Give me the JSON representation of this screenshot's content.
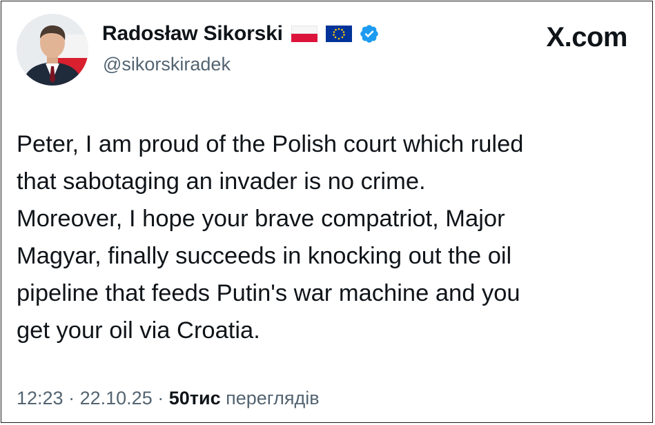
{
  "author": {
    "display_name": "Radosław Sikorski",
    "handle": "@sikorskiradek",
    "badges": [
      "flag-poland-icon",
      "flag-eu-icon",
      "verified-badge-icon"
    ]
  },
  "brand": {
    "label": "X.com"
  },
  "tweet": {
    "text": "Peter, I am proud of the Polish court which ruled\nthat sabotaging an invader is no crime.\nMoreover, I hope your brave compatriot, Major\nMagyar, finally succeeds in knocking out the oil\npipeline that feeds Putin's war machine and you\nget your oil via Croatia."
  },
  "meta": {
    "time": "12:23",
    "separator": "·",
    "date": "22.10.25",
    "views_count": "50тис",
    "views_label": "переглядів"
  },
  "colors": {
    "text_primary": "#0f1419",
    "text_secondary": "#536471",
    "verified_blue": "#1d9bf0",
    "poland_red": "#dc143c",
    "eu_blue": "#003399",
    "eu_star": "#ffcc00"
  }
}
